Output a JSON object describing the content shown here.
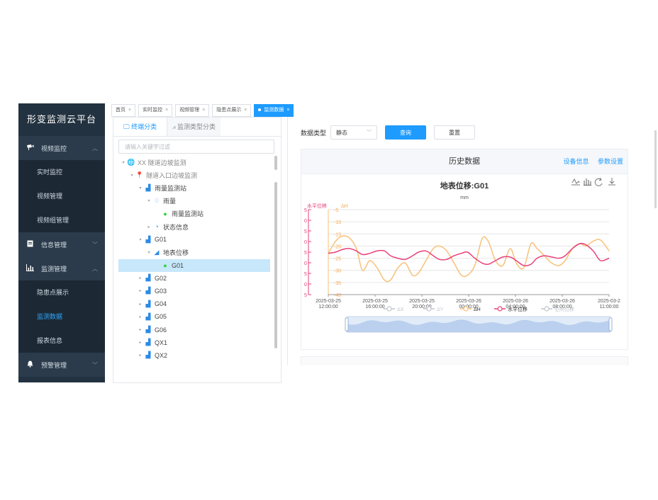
{
  "sidebar": {
    "title": "形变监测云平台",
    "groups": [
      {
        "label": "视频监控",
        "icon": "camera-icon",
        "expanded": true,
        "items": [
          {
            "label": "实时监控"
          },
          {
            "label": "视频管理"
          },
          {
            "label": "视频组管理"
          }
        ]
      },
      {
        "label": "信息管理",
        "icon": "document-icon",
        "expanded": false,
        "items": []
      },
      {
        "label": "监测管理",
        "icon": "bar-chart-icon",
        "expanded": true,
        "items": [
          {
            "label": "隐患点展示"
          },
          {
            "label": "监测数据",
            "active": true
          },
          {
            "label": "报表信息"
          }
        ]
      },
      {
        "label": "预警管理",
        "icon": "bell-icon",
        "expanded": false,
        "items": []
      }
    ]
  },
  "tabs": [
    {
      "label": "首页"
    },
    {
      "label": "实时监控"
    },
    {
      "label": "视频管理"
    },
    {
      "label": "隐患点展示"
    },
    {
      "label": "监测数据",
      "active": true
    }
  ],
  "tree": {
    "tabs": [
      {
        "label": "终端分类",
        "active": true,
        "icon": "monitor-icon"
      },
      {
        "label": "监测类型分类",
        "icon": "trend-icon"
      }
    ],
    "search_placeholder": "请输入关键字过滤",
    "nodes": [
      {
        "label": "XX 隧道边坡监测",
        "level": 0,
        "arrow": "▾",
        "icon": "globe-icon",
        "muted": true
      },
      {
        "label": "隧道入口边坡监测",
        "level": 1,
        "arrow": "▾",
        "icon": "location-icon",
        "muted": true
      },
      {
        "label": "雨量监测站",
        "level": 2,
        "arrow": "▾",
        "icon": "station-icon"
      },
      {
        "label": "雨量",
        "level": 3,
        "arrow": "▾",
        "icon": "rain-icon"
      },
      {
        "label": "雨量监测站",
        "level": 4,
        "arrow": "",
        "icon": "status-dot-icon",
        "green": true
      },
      {
        "label": "状态信息",
        "level": 3,
        "arrow": "▸",
        "icon": "status-icon"
      },
      {
        "label": "G01",
        "level": 2,
        "arrow": "▾",
        "icon": "station-icon"
      },
      {
        "label": "地表位移",
        "level": 3,
        "arrow": "▾",
        "icon": "displacement-icon"
      },
      {
        "label": "G01",
        "level": 4,
        "arrow": "",
        "icon": "status-dot-icon",
        "green": true,
        "selected": true
      },
      {
        "label": "G02",
        "level": 2,
        "arrow": "▸",
        "icon": "station-icon"
      },
      {
        "label": "G03",
        "level": 2,
        "arrow": "▸",
        "icon": "station-icon"
      },
      {
        "label": "G04",
        "level": 2,
        "arrow": "▸",
        "icon": "station-icon"
      },
      {
        "label": "G05",
        "level": 2,
        "arrow": "▸",
        "icon": "station-icon"
      },
      {
        "label": "G06",
        "level": 2,
        "arrow": "▸",
        "icon": "station-icon"
      },
      {
        "label": "QX1",
        "level": 2,
        "arrow": "▸",
        "icon": "station-icon"
      },
      {
        "label": "QX2",
        "level": 2,
        "arrow": "▸",
        "icon": "station-icon"
      }
    ]
  },
  "filter": {
    "label": "数据类型",
    "value": "静态",
    "query_button": "查询",
    "reset_button": "重置"
  },
  "card": {
    "title": "历史数据",
    "links": [
      "设备信息",
      "参数设置"
    ]
  },
  "chart_data": {
    "type": "line",
    "title": "地表位移:G01",
    "subtitle": "mm",
    "left_axis_label": "水平位移",
    "right_axis_label": "ΔH",
    "left_axis_ticks": [
      "5",
      "0",
      "5",
      "0",
      "5",
      "0",
      "5",
      "0",
      "5"
    ],
    "right_axis_ticks": [
      -5,
      -10,
      -15,
      -20,
      -25,
      -30,
      -35,
      -40
    ],
    "right_axis_range": [
      -40,
      -5
    ],
    "x_tick_labels": [
      [
        "2025-03-25",
        "12:00:00"
      ],
      [
        "2025-03-25",
        "16:00:00"
      ],
      [
        "2025-03-25",
        "20:00:00"
      ],
      [
        "2025-03-26",
        "00:00:00"
      ],
      [
        "2025-03-26",
        "04:00:00"
      ],
      [
        "2025-03-26",
        "08:00:00"
      ],
      [
        "2025-03-2",
        "11:00:00"
      ]
    ],
    "x_range_hours": [
      0,
      23
    ],
    "legend": [
      {
        "name": "ΔX",
        "color": "#c0c4cc",
        "active": false
      },
      {
        "name": "ΔY",
        "color": "#c0c4cc",
        "active": false
      },
      {
        "name": "ΔH",
        "color": "#f8c078",
        "active": true
      },
      {
        "name": "水平位移",
        "color": "#e8407b",
        "active": true
      },
      {
        "name": "空间位移",
        "color": "#c0c4cc",
        "active": false
      }
    ],
    "series": [
      {
        "name": "ΔH",
        "color": "#f8c078",
        "x": [
          0,
          0.6,
          1.1,
          1.7,
          2.3,
          2.8,
          3.4,
          4,
          4.6,
          5.1,
          5.7,
          6.3,
          6.9,
          7.4,
          8,
          8.6,
          9.1,
          9.7,
          10.3,
          10.9,
          11.4,
          12,
          12.6,
          13.1,
          13.7,
          14.3,
          14.9,
          15.4,
          16,
          16.6,
          17.1,
          17.7,
          18.3,
          18.9,
          19.4,
          20,
          20.6,
          21.1,
          21.7,
          22.3,
          23
        ],
        "y": [
          -23,
          -18,
          -16,
          -16.5,
          -21,
          -30,
          -26,
          -29,
          -34,
          -34,
          -29,
          -27,
          -32,
          -31,
          -26,
          -21,
          -20,
          -22,
          -27,
          -32,
          -32,
          -28,
          -17,
          -18,
          -26,
          -28,
          -21,
          -27,
          -29,
          -19,
          -21,
          -24,
          -27,
          -28,
          -26,
          -21,
          -19,
          -20,
          -18,
          -17.5,
          -22
        ]
      },
      {
        "name": "水平位移",
        "color": "#e8407b",
        "x": [
          0,
          0.6,
          1.1,
          1.7,
          2.3,
          2.8,
          3.4,
          4,
          4.6,
          5.1,
          5.7,
          6.3,
          6.9,
          7.4,
          8,
          8.6,
          9.1,
          9.7,
          10.3,
          10.9,
          11.4,
          12,
          12.6,
          13.1,
          13.7,
          14.3,
          14.9,
          15.4,
          16,
          16.6,
          17.1,
          17.7,
          18.3,
          18.9,
          19.4,
          20,
          20.6,
          21.1,
          21.7,
          22.3,
          23
        ],
        "y": [
          -23,
          -22.5,
          -21.5,
          -21,
          -22,
          -23.5,
          -23,
          -22,
          -22,
          -24,
          -25,
          -25.5,
          -24,
          -22.5,
          -22,
          -24,
          -25.5,
          -25.5,
          -24,
          -23,
          -22.5,
          -25,
          -27,
          -27.5,
          -26,
          -24.5,
          -24.5,
          -26,
          -28,
          -27.5,
          -25,
          -24,
          -24.5,
          -25,
          -24,
          -21,
          -19,
          -19.5,
          -22,
          -26,
          -25
        ]
      }
    ],
    "grid": true
  }
}
